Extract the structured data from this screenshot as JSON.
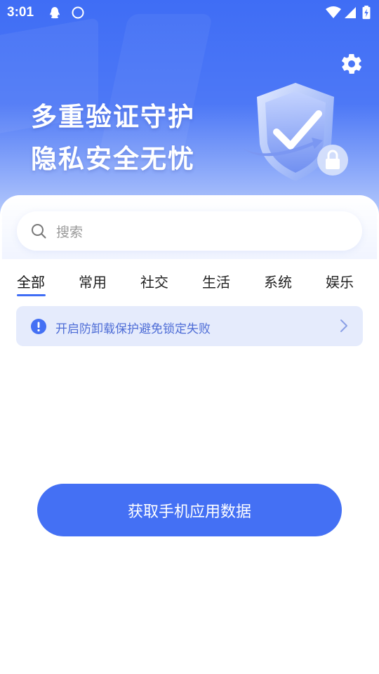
{
  "status_bar": {
    "time": "3:01"
  },
  "hero": {
    "line1": "多重验证守护",
    "line2": "隐私安全无忧"
  },
  "search": {
    "placeholder": "搜索"
  },
  "tabs": [
    {
      "label": "全部",
      "active": true
    },
    {
      "label": "常用"
    },
    {
      "label": "社交"
    },
    {
      "label": "生活"
    },
    {
      "label": "系统"
    },
    {
      "label": "娱乐"
    }
  ],
  "notice": {
    "text": "开启防卸载保护避免锁定失败"
  },
  "cta": {
    "label": "获取手机应用数据"
  },
  "icons": {
    "settings": "gear-icon",
    "search": "search-icon",
    "notice": "exclamation-icon",
    "chevron": "chevron-right-icon"
  },
  "colors": {
    "accent": "#3f6df5",
    "notice_bg": "#e5ebfc",
    "notice_text": "#4d6cd6"
  }
}
